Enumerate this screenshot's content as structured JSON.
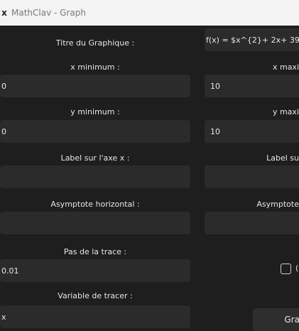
{
  "window": {
    "title": "MathClav - Graph",
    "icon": "mathclav-app-icon"
  },
  "form": {
    "title_label": "Titre du Graphique :",
    "title_value": "f(x) = $x^{2}+ 2x+ 39",
    "xmin_label": "x minimum :",
    "xmin_value": "0",
    "xmax_label": "x maxi",
    "xmax_value": "10",
    "ymin_label": "y minimum :",
    "ymin_value": "0",
    "ymax_label": "y maxi",
    "ymax_value": "10",
    "xaxis_label": "Label sur l'axe x :",
    "xaxis_value": "",
    "yaxis_label": "Label su",
    "yaxis_value": "",
    "hasym_label": "Asymptote horizontal :",
    "hasym_value": "",
    "vasym_label": "Asymptote",
    "vasym_value": "",
    "step_label": "Pas de la trace :",
    "step_value": "0.01",
    "checkbox_label": "(",
    "var_label": "Variable de tracer :",
    "var_value": "x",
    "graph_button": "Gra"
  }
}
